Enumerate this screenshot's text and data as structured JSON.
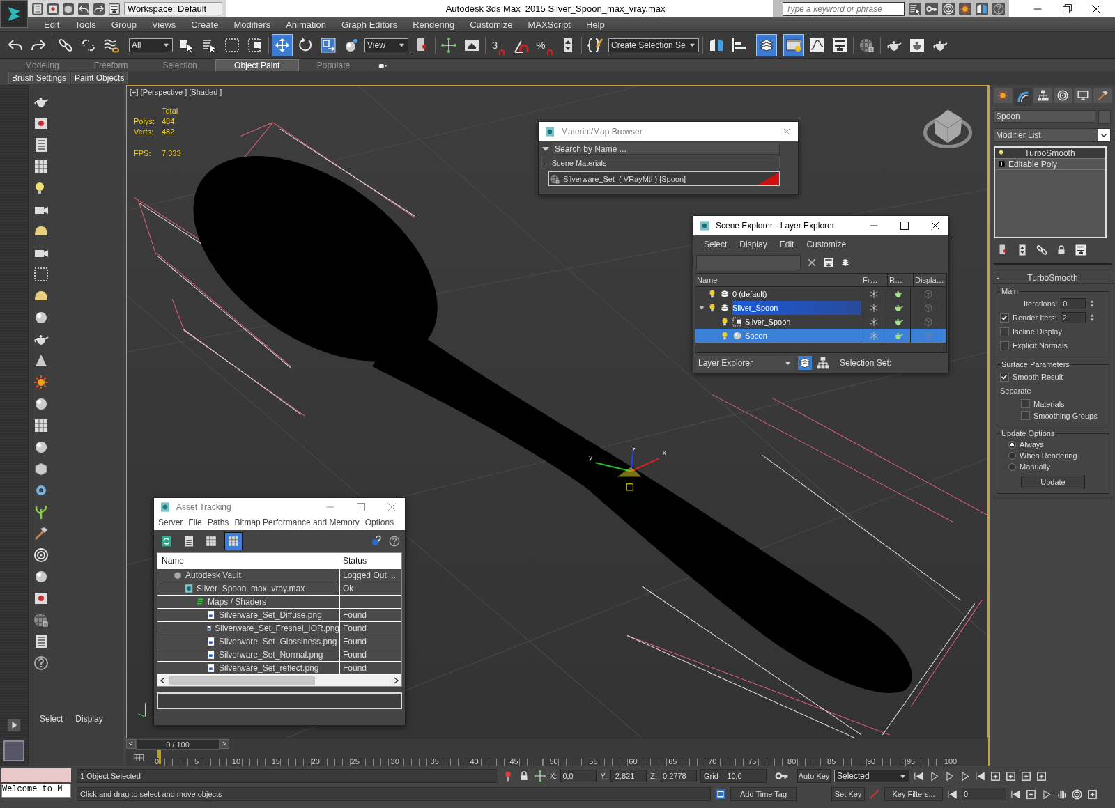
{
  "title_bar": {
    "workspace": "Workspace: Default",
    "app_name": "Autodesk 3ds Max  2015",
    "file_name": "Silver_Spoon_max_vray.max",
    "search": {
      "placeholder": "Type a keyword or phrase"
    }
  },
  "menu_bar": [
    "Edit",
    "Tools",
    "Group",
    "Views",
    "Create",
    "Modifiers",
    "Animation",
    "Graph Editors",
    "Rendering",
    "Customize",
    "MAXScript",
    "Help"
  ],
  "main_toolbar": [
    {
      "kind": "undo",
      "selected": false
    },
    {
      "kind": "redo",
      "selected": false
    },
    {
      "kind": "separator"
    },
    {
      "kind": "link",
      "selected": false
    },
    {
      "kind": "unlink",
      "selected": false
    },
    {
      "kind": "bind",
      "selected": false
    },
    {
      "kind": "separator"
    },
    {
      "kind": "dropdown",
      "value": "All"
    },
    {
      "kind": "select",
      "selected": false
    },
    {
      "kind": "select_name",
      "selected": false
    },
    {
      "kind": "region",
      "selected": false
    },
    {
      "kind": "crossing",
      "selected": false
    },
    {
      "kind": "separator"
    },
    {
      "kind": "move",
      "selected": true
    },
    {
      "kind": "rotate",
      "selected": false
    },
    {
      "kind": "scale",
      "selected": false
    },
    {
      "kind": "place",
      "selected": false
    },
    {
      "kind": "dropdown",
      "value": "View"
    },
    {
      "kind": "pivot",
      "selected": false
    },
    {
      "kind": "separator"
    },
    {
      "kind": "axis",
      "selected": false
    },
    {
      "kind": "keyboard",
      "selected": false
    },
    {
      "kind": "separator"
    },
    {
      "kind": "snap",
      "label": "3",
      "selected": false
    },
    {
      "kind": "angle_snap",
      "selected": false
    },
    {
      "kind": "snap",
      "label": "%",
      "selected": false
    },
    {
      "kind": "spinner",
      "selected": false
    },
    {
      "kind": "separator"
    },
    {
      "kind": "named_sets",
      "selected": false
    },
    {
      "kind": "dropdown",
      "value": "Create Selection Se"
    },
    {
      "kind": "separator"
    },
    {
      "kind": "mirror",
      "selected": false
    },
    {
      "kind": "align",
      "selected": false
    },
    {
      "kind": "separator"
    },
    {
      "kind": "layers",
      "selected": true
    },
    {
      "kind": "separator"
    },
    {
      "kind": "explorer",
      "selected": true
    },
    {
      "kind": "curve",
      "selected": false
    },
    {
      "kind": "schematic",
      "selected": false
    },
    {
      "kind": "separator"
    },
    {
      "kind": "material",
      "selected": false
    },
    {
      "kind": "separator"
    },
    {
      "kind": "render_setup",
      "selected": false
    },
    {
      "kind": "frame_window",
      "selected": false
    },
    {
      "kind": "render",
      "selected": false
    }
  ],
  "ribbon": {
    "tabs": [
      {
        "label": "Modeling",
        "selected": false
      },
      {
        "label": "Freeform",
        "selected": false
      },
      {
        "label": "Selection",
        "selected": false
      },
      {
        "label": "Object Paint",
        "selected": true
      },
      {
        "label": "Populate",
        "selected": false
      }
    ],
    "panels": [
      "Brush Settings",
      "Paint Objects"
    ]
  },
  "left_panel": {
    "tabs": [
      "Select",
      "Display"
    ]
  },
  "viewport": {
    "label": "[+] [Perspective ] [Shaded ]",
    "stats_header": "Total",
    "stats": [
      {
        "label": "Polys:",
        "value": "484"
      },
      {
        "label": "Verts:",
        "value": "482"
      }
    ],
    "fps_label": "FPS:",
    "fps": "7,333",
    "gizmo_axes": [
      "x",
      "y",
      "z"
    ]
  },
  "material_browser": {
    "title": "Material/Map Browser",
    "search_placeholder": "Search by Name ...",
    "group_toggle": "-",
    "group": "Scene Materials",
    "item": "Silverware_Set  ( VRayMtl ) [Spoon]"
  },
  "scene_explorer": {
    "title": "Scene Explorer - Layer Explorer",
    "menu": [
      "Select",
      "Display",
      "Edit",
      "Customize"
    ],
    "columns": [
      "Name",
      "Fr…",
      "R…",
      "Displa…"
    ],
    "tree": [
      {
        "name": "0 (default)",
        "kind": "layer",
        "selected": false
      },
      {
        "name": "Silver_Spoon",
        "kind": "layer",
        "selected": true,
        "children": [
          {
            "name": "Silver_Spoon",
            "kind": "group",
            "selected": false
          },
          {
            "name": "Spoon",
            "kind": "object",
            "selected": true
          }
        ]
      }
    ],
    "mode": "Layer Explorer",
    "selection_set_label": "Selection Set:"
  },
  "command_panel": {
    "tabs": [
      {
        "kind": "create",
        "selected": false
      },
      {
        "kind": "modify",
        "selected": true
      },
      {
        "kind": "hierarchy",
        "selected": false
      },
      {
        "kind": "motion",
        "selected": false
      },
      {
        "kind": "display",
        "selected": false
      },
      {
        "kind": "utilities",
        "selected": false
      }
    ],
    "object_name": "Spoon",
    "modifier_list": "Modifier List",
    "stack": [
      {
        "name": "TurboSmooth",
        "kind": "modifier",
        "selected": true
      },
      {
        "name": "Editable Poly",
        "kind": "base",
        "selected": false
      }
    ],
    "rollout_toggle": "-",
    "rollout": "TurboSmooth",
    "groups": [
      {
        "title": "Main",
        "items": [
          {
            "kind": "spinner",
            "label": "Iterations:",
            "value": "0"
          },
          {
            "kind": "check_spinner",
            "label": "Render Iters:",
            "checked": true,
            "value": "2"
          },
          {
            "kind": "check",
            "label": "Isoline Display",
            "checked": false
          },
          {
            "kind": "check",
            "label": "Explicit Normals",
            "checked": false
          }
        ]
      },
      {
        "title": "Surface Parameters",
        "items": [
          {
            "kind": "check",
            "label": "Smooth Result",
            "checked": true
          },
          {
            "kind": "label",
            "label": "Separate"
          },
          {
            "kind": "subcheck",
            "label": "Materials",
            "checked": false
          },
          {
            "kind": "subcheck",
            "label": "Smoothing Groups",
            "checked": false
          }
        ]
      },
      {
        "title": "Update Options",
        "items": [
          {
            "kind": "radio",
            "label": "Always",
            "selected": true
          },
          {
            "kind": "radio",
            "label": "When Rendering",
            "selected": false
          },
          {
            "kind": "radio",
            "label": "Manually",
            "selected": false
          },
          {
            "kind": "button",
            "label": "Update"
          }
        ]
      }
    ]
  },
  "asset_tracking": {
    "title": "Asset Tracking",
    "menu": [
      "Server",
      "File",
      "Paths",
      "Bitmap Performance and Memory",
      "Options"
    ],
    "view_modes": [
      {
        "kind": "refresh",
        "selected": false
      },
      {
        "kind": "list",
        "selected": false
      },
      {
        "kind": "thumbs",
        "selected": false
      },
      {
        "kind": "table",
        "selected": true
      }
    ],
    "columns": [
      "Name",
      "Status"
    ],
    "tree": [
      {
        "name": "Autodesk Vault",
        "kind": "vault",
        "status": "Logged Out ...",
        "children": [
          {
            "name": "Silver_Spoon_max_vray.max",
            "kind": "max",
            "status": "Ok",
            "children": [
              {
                "name": "Maps / Shaders",
                "kind": "maps",
                "children": [
                  {
                    "name": "Silverware_Set_Diffuse.png",
                    "kind": "image",
                    "status": "Found"
                  },
                  {
                    "name": "Silverware_Set_Fresnel_IOR.png",
                    "kind": "image",
                    "status": "Found"
                  },
                  {
                    "name": "Silverware_Set_Glossiness.png",
                    "kind": "image",
                    "status": "Found"
                  },
                  {
                    "name": "Silverware_Set_Normal.png",
                    "kind": "image",
                    "status": "Found"
                  },
                  {
                    "name": "Silverware_Set_reflect.png",
                    "kind": "image",
                    "status": "Found"
                  }
                ]
              }
            ]
          }
        ]
      }
    ]
  },
  "timeline": {
    "frame": "0 / 100",
    "level": 0,
    "prev": "<",
    "next": ">",
    "ticks": [
      "0",
      "5",
      "10",
      "15",
      "20",
      "25",
      "30",
      "35",
      "40",
      "45",
      "50",
      "55",
      "60",
      "65",
      "70",
      "75",
      "80",
      "85",
      "90",
      "95",
      "100"
    ]
  },
  "status_bar": {
    "listener": "Welcome to M",
    "selection": "1 Object Selected",
    "prompt": "Click and drag to select and move objects",
    "coords": [
      {
        "label": "X:",
        "value": "0,0"
      },
      {
        "label": "Y:",
        "value": "-2,821"
      },
      {
        "label": "Z:",
        "value": "0,2778"
      }
    ],
    "grid": "Grid = 10,0",
    "auto_key": "Auto Key",
    "key_mode": "Selected",
    "set_key": "Set Key",
    "key_filters": "Key Filters...",
    "add_time_tag": "Add Time Tag",
    "current_frame": "0"
  }
}
